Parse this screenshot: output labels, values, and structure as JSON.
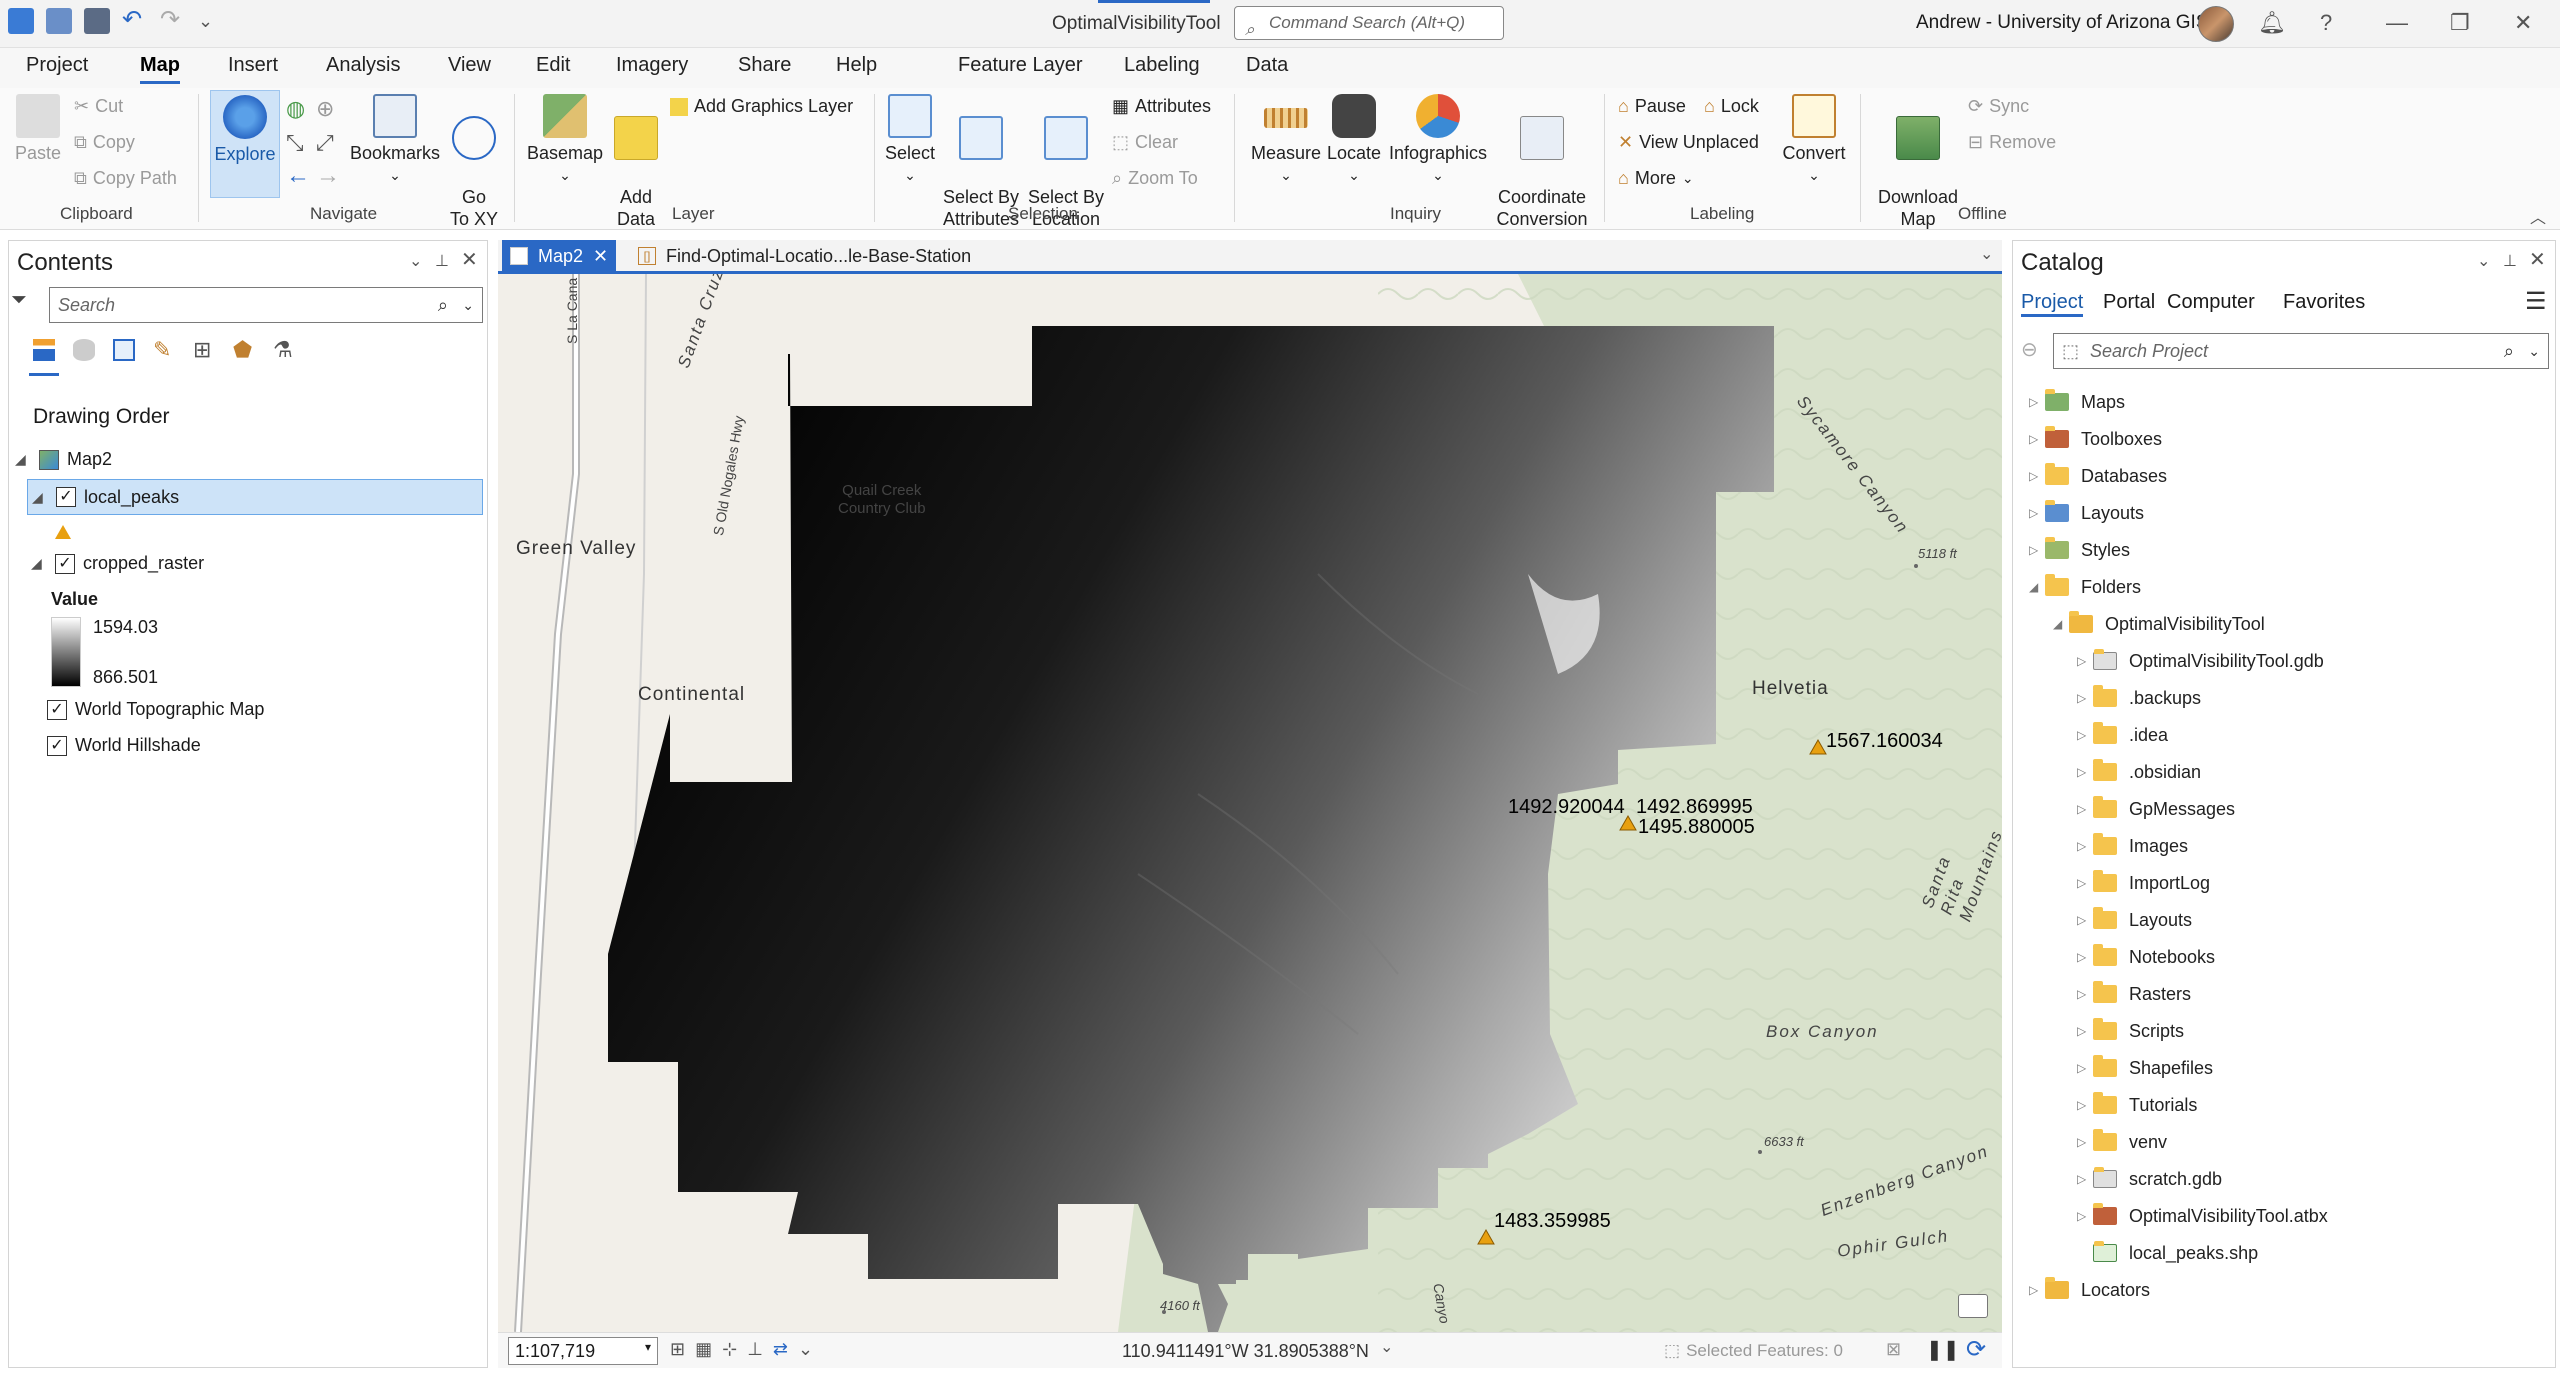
{
  "window": {
    "app_title": "OptimalVisibilityTool",
    "command_search_placeholder": "Command Search (Alt+Q)",
    "user": "Andrew - University of Arizona GIS"
  },
  "ribbon_tabs": [
    "Project",
    "Map",
    "Insert",
    "Analysis",
    "View",
    "Edit",
    "Imagery",
    "Share",
    "Help"
  ],
  "active_tab": "Map",
  "context_tabs": [
    "Feature Layer",
    "Labeling",
    "Data"
  ],
  "ribbon": {
    "clipboard": {
      "label": "Clipboard",
      "paste": "Paste",
      "cut": "Cut",
      "copy": "Copy",
      "copy_path": "Copy Path"
    },
    "navigate": {
      "label": "Navigate",
      "explore": "Explore",
      "bookmarks": "Bookmarks",
      "goto": "Go\nTo XY"
    },
    "layer": {
      "label": "Layer",
      "basemap": "Basemap",
      "add_data": "Add\nData",
      "add_graphics": "Add Graphics Layer"
    },
    "selection": {
      "label": "Selection",
      "select": "Select",
      "by_attr": "Select By\nAttributes",
      "by_loc": "Select By\nLocation",
      "attributes": "Attributes",
      "clear": "Clear",
      "zoom_to": "Zoom To"
    },
    "inquiry": {
      "label": "Inquiry",
      "measure": "Measure",
      "locate": "Locate",
      "infographics": "Infographics",
      "coord": "Coordinate\nConversion"
    },
    "labeling": {
      "label": "Labeling",
      "pause": "Pause",
      "lock": "Lock",
      "view_unplaced": "View Unplaced",
      "more": "More",
      "convert": "Convert"
    },
    "offline": {
      "label": "Offline",
      "download": "Download\nMap",
      "sync": "Sync",
      "remove": "Remove"
    }
  },
  "contents": {
    "title": "Contents",
    "search_placeholder": "Search",
    "section": "Drawing Order",
    "map_name": "Map2",
    "layers": [
      {
        "name": "local_peaks",
        "checked": true
      },
      {
        "name": "cropped_raster",
        "checked": true
      },
      {
        "name": "World Topographic Map",
        "checked": true
      },
      {
        "name": "World Hillshade",
        "checked": true
      }
    ],
    "legend": {
      "title": "Value",
      "max": "1594.03",
      "min": "866.501"
    }
  },
  "doc_tabs": [
    "Map2",
    "Find-Optimal-Locatio...le-Base-Station"
  ],
  "map": {
    "places": [
      "Green Valley",
      "Continental",
      "Quail Creek\nCountry Club",
      "Helvetia",
      "Santa Cruz Valley",
      "S Old Nogales Hwy",
      "Sycamore Canyon",
      "Santa Rita Mountains",
      "Box Canyon",
      "Enzenberg Canyon",
      "Ophir Gulch",
      "S La Cana",
      "Canyo"
    ],
    "elev": [
      "5118 ft",
      "6633 ft",
      "4160 ft"
    ],
    "peaks": [
      "1567.160034",
      "1492.920044",
      "1492.869995",
      "1495.880005",
      "1483.359985"
    ]
  },
  "status": {
    "scale": "1:107,719",
    "coords": "110.9411491°W 31.8905388°N",
    "selected": "Selected Features: 0"
  },
  "catalog": {
    "title": "Catalog",
    "tabs": [
      "Project",
      "Portal",
      "Computer",
      "Favorites"
    ],
    "search_placeholder": "Search Project",
    "items": [
      "Maps",
      "Toolboxes",
      "Databases",
      "Layouts",
      "Styles",
      "Folders"
    ],
    "project_folder": "OptimalVisibilityTool",
    "folder_items": [
      "OptimalVisibilityTool.gdb",
      ".backups",
      ".idea",
      ".obsidian",
      "GpMessages",
      "Images",
      "ImportLog",
      "Layouts",
      "Notebooks",
      "Rasters",
      "Scripts",
      "Shapefiles",
      "Tutorials",
      "venv",
      "scratch.gdb",
      "OptimalVisibilityTool.atbx",
      "local_peaks.shp"
    ],
    "locators": "Locators"
  }
}
